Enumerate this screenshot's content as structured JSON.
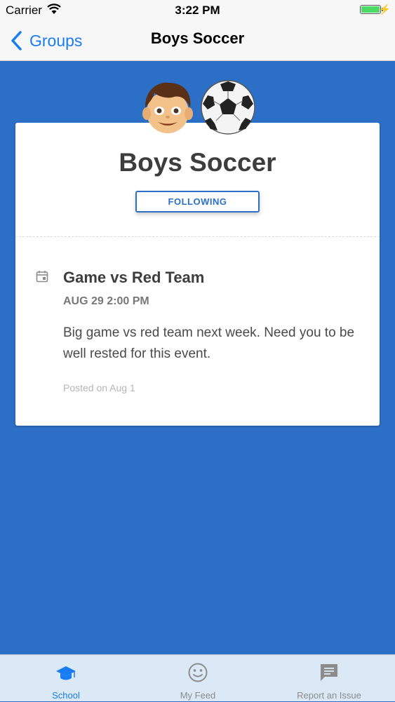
{
  "status_bar": {
    "carrier": "Carrier",
    "time": "3:22 PM",
    "battery_level": 1.0
  },
  "nav": {
    "back_label": "Groups",
    "title": "Boys Soccer"
  },
  "group": {
    "name": "Boys Soccer",
    "emoji": [
      "boy-emoji",
      "soccer-ball-emoji"
    ],
    "follow_label": "FOLLOWING"
  },
  "event": {
    "icon": "calendar-icon",
    "title": "Game vs Red Team",
    "datetime": "AUG 29 2:00 PM",
    "description": "Big game vs red team next week. Need you to be well rested for this event.",
    "posted": "Posted on Aug 1"
  },
  "tabs": [
    {
      "label": "School",
      "icon": "graduation-cap-icon",
      "active": true
    },
    {
      "label": "My Feed",
      "icon": "smiley-icon",
      "active": false
    },
    {
      "label": "Report an Issue",
      "icon": "chat-bubble-icon",
      "active": false
    }
  ],
  "colors": {
    "background": "#2c6fc7",
    "accent": "#1a7cf3",
    "tab_bar": "#dbe9f7"
  }
}
